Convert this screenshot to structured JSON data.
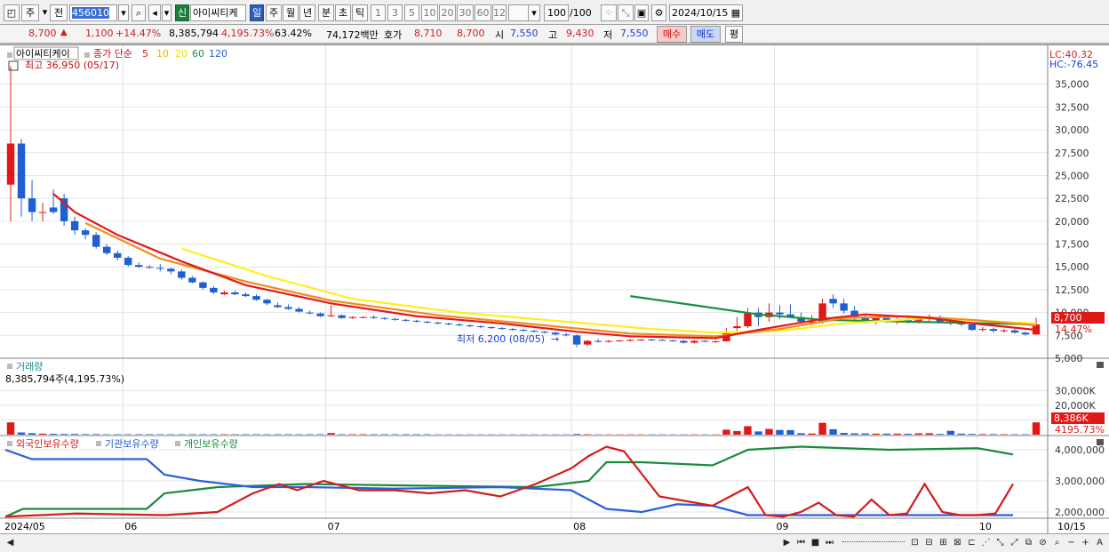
{
  "toolbar": {
    "market": "주",
    "prev": "전",
    "code": "456010",
    "badge": "신",
    "name": "아이씨티케",
    "periods": [
      "일",
      "주",
      "월",
      "년",
      "분",
      "초",
      "틱"
    ],
    "active_period": "일",
    "intervals": [
      "1",
      "3",
      "5",
      "10",
      "20",
      "30",
      "60",
      "120"
    ],
    "count": "100",
    "count_total": "/100",
    "date": "2024/10/15"
  },
  "quote": {
    "price": "8,700",
    "change_arrow": "▲",
    "change": "1,100",
    "change_rate": "+14.47%",
    "volume": "8,385,794",
    "volume_rate": "4,195.73%",
    "turnover": "63.42%",
    "amount": "74,172백만",
    "bid_label": "호가",
    "bid1": "8,710",
    "bid2": "8,700",
    "open_label": "시",
    "open": "7,550",
    "high_label": "고",
    "high": "9,430",
    "low_label": "저",
    "low": "7,550",
    "buy": "매수",
    "sell": "매도",
    "eval": "평"
  },
  "chart": {
    "legend_name": "아이씨티케이",
    "legend_ma_label": "종가 단순",
    "legend_ma": [
      {
        "label": "5",
        "color": "#e01b1b"
      },
      {
        "label": "10",
        "color": "#f0b400"
      },
      {
        "label": "20",
        "color": "#e8e000"
      },
      {
        "label": "60",
        "color": "#1a9040"
      },
      {
        "label": "120",
        "color": "#2060d0"
      }
    ],
    "lc": "LC:40.32",
    "hc": "HC:-76.45",
    "high_note": "최고 36,950 (05/17)",
    "low_note": "최저 6,200 (08/05)",
    "price_ticks": [
      "35,000",
      "32,500",
      "30,000",
      "27,500",
      "25,000",
      "22,500",
      "20,000",
      "17,500",
      "15,000",
      "12,500",
      "10,000",
      "7,500",
      "5,000"
    ],
    "price_tag": "8,700",
    "price_rate_tag": "14.47%",
    "volume_title": "거래량",
    "volume_info": "8,385,794주(4,195.73%)",
    "volume_ticks": [
      "30,000K",
      "20,000K",
      "10,000K"
    ],
    "volume_tag": "8,386K",
    "volume_rate_tag": "4195.73%",
    "holding_legend": [
      {
        "label": "외국인보유수량",
        "color": "#d41c1c"
      },
      {
        "label": "기관보유수량",
        "color": "#2060d0"
      },
      {
        "label": "개인보유수량",
        "color": "#1a8a3a"
      }
    ],
    "holding_ticks": [
      "4,000,000",
      "3,000,000",
      "2,000,000"
    ],
    "x_labels": [
      "2024/05",
      "06",
      "07",
      "08",
      "09",
      "10",
      "10/15"
    ]
  },
  "chart_data": {
    "type": "candlestick",
    "ohlc_daily": [
      [
        24000,
        36950,
        20000,
        28500
      ],
      [
        28500,
        29000,
        20500,
        22500
      ],
      [
        22500,
        24500,
        20000,
        21000
      ],
      [
        21000,
        22000,
        20000,
        21000
      ],
      [
        21500,
        23500,
        20800,
        21000
      ],
      [
        22500,
        23000,
        19500,
        20000
      ],
      [
        20000,
        20500,
        18500,
        19000
      ],
      [
        19000,
        19200,
        18000,
        18500
      ],
      [
        18500,
        18800,
        17000,
        17200
      ],
      [
        17200,
        17500,
        16300,
        16500
      ],
      [
        16500,
        16800,
        15700,
        16000
      ],
      [
        16000,
        16200,
        15000,
        15200
      ],
      [
        15200,
        15500,
        14900,
        15000
      ],
      [
        15000,
        15200,
        14800,
        14900
      ],
      [
        14900,
        15300,
        14500,
        14800
      ],
      [
        14800,
        14900,
        14200,
        14500
      ],
      [
        14500,
        14700,
        13600,
        13800
      ],
      [
        13800,
        14000,
        13200,
        13300
      ],
      [
        13300,
        13400,
        12500,
        12700
      ],
      [
        12700,
        12900,
        12000,
        12200
      ],
      [
        12000,
        12400,
        11900,
        12200
      ],
      [
        12200,
        12400,
        11900,
        12000
      ],
      [
        12000,
        12200,
        11700,
        11800
      ],
      [
        11800,
        12000,
        11300,
        11400
      ],
      [
        11400,
        11500,
        10800,
        11000
      ],
      [
        10800,
        11100,
        10500,
        10600
      ],
      [
        10600,
        10900,
        10300,
        10400
      ],
      [
        10400,
        10600,
        10000,
        10100
      ],
      [
        10000,
        10200,
        9800,
        9900
      ],
      [
        9900,
        10000,
        9500,
        9600
      ],
      [
        9600,
        10800,
        9500,
        9700
      ],
      [
        9700,
        9800,
        9300,
        9400
      ],
      [
        9400,
        9600,
        9300,
        9500
      ],
      [
        9500,
        9600,
        9400,
        9500
      ],
      [
        9500,
        9700,
        9300,
        9400
      ],
      [
        9400,
        9500,
        9200,
        9300
      ],
      [
        9300,
        9400,
        9100,
        9200
      ],
      [
        9200,
        9300,
        9000,
        9100
      ],
      [
        9100,
        9200,
        8900,
        9000
      ],
      [
        9000,
        9100,
        8800,
        8900
      ],
      [
        8900,
        9000,
        8700,
        8800
      ],
      [
        8800,
        8900,
        8600,
        8700
      ],
      [
        8700,
        8800,
        8500,
        8600
      ],
      [
        8600,
        8700,
        8400,
        8500
      ],
      [
        8500,
        8600,
        8300,
        8400
      ],
      [
        8400,
        8500,
        8200,
        8300
      ],
      [
        8300,
        8400,
        8100,
        8200
      ],
      [
        8200,
        8300,
        8000,
        8100
      ],
      [
        8100,
        8200,
        7900,
        8000
      ],
      [
        8000,
        8100,
        7800,
        7900
      ],
      [
        7900,
        8000,
        7700,
        7800
      ],
      [
        7800,
        7900,
        7500,
        7600
      ],
      [
        7600,
        7800,
        7400,
        7500
      ],
      [
        7500,
        7600,
        6200,
        6500
      ],
      [
        6500,
        7000,
        6300,
        6900
      ],
      [
        6900,
        7100,
        6700,
        6800
      ],
      [
        6800,
        7000,
        6700,
        6900
      ],
      [
        6900,
        7000,
        6800,
        6950
      ],
      [
        6950,
        7100,
        6850,
        7000
      ],
      [
        7000,
        7100,
        6900,
        7050
      ],
      [
        7050,
        7150,
        6900,
        7000
      ],
      [
        7000,
        7100,
        6900,
        6950
      ],
      [
        6950,
        7000,
        6800,
        6900
      ],
      [
        6900,
        7000,
        6600,
        6700
      ],
      [
        6700,
        7000,
        6600,
        6900
      ],
      [
        6900,
        7000,
        6750,
        6800
      ],
      [
        6800,
        7000,
        6700,
        6850
      ],
      [
        6850,
        8300,
        6800,
        7900
      ],
      [
        8300,
        9500,
        8000,
        8500
      ],
      [
        8500,
        10500,
        8300,
        10000
      ],
      [
        10000,
        10500,
        8500,
        9500
      ],
      [
        9500,
        11000,
        9000,
        10000
      ],
      [
        10000,
        10800,
        9300,
        9800
      ],
      [
        9800,
        10900,
        9400,
        9500
      ],
      [
        9500,
        10000,
        8800,
        9000
      ],
      [
        9000,
        9700,
        8600,
        9000
      ],
      [
        9000,
        11500,
        8800,
        11000
      ],
      [
        11500,
        12000,
        10500,
        11000
      ],
      [
        11000,
        11500,
        9900,
        10200
      ],
      [
        10200,
        10700,
        9200,
        9400
      ],
      [
        9400,
        9800,
        8800,
        9000
      ],
      [
        9000,
        9500,
        8700,
        9400
      ],
      [
        9400,
        9700,
        8900,
        9000
      ],
      [
        9000,
        9600,
        8700,
        9200
      ],
      [
        9200,
        9500,
        8800,
        9100
      ],
      [
        9100,
        9500,
        8800,
        9300
      ],
      [
        9300,
        9800,
        8900,
        9500
      ],
      [
        9500,
        9700,
        8900,
        9000
      ],
      [
        9000,
        9200,
        8600,
        8800
      ],
      [
        8800,
        9000,
        8500,
        8700
      ],
      [
        8700,
        8900,
        8000,
        8100
      ],
      [
        8100,
        8400,
        7900,
        8200
      ],
      [
        8200,
        8300,
        7800,
        8000
      ],
      [
        8000,
        8200,
        7800,
        8050
      ],
      [
        8050,
        8200,
        7700,
        7800
      ],
      [
        7800,
        7900,
        7500,
        7600
      ],
      [
        7600,
        9430,
        7550,
        8700
      ]
    ],
    "ma5": [
      [
        4,
        23000
      ],
      [
        6,
        21000
      ],
      [
        10,
        18500
      ],
      [
        16,
        15600
      ],
      [
        22,
        13000
      ],
      [
        30,
        11000
      ],
      [
        38,
        9600
      ],
      [
        46,
        8800
      ],
      [
        53,
        7900
      ],
      [
        58,
        7400
      ],
      [
        66,
        7200
      ],
      [
        70,
        8100
      ],
      [
        76,
        9300
      ],
      [
        80,
        9800
      ],
      [
        86,
        9400
      ],
      [
        91,
        8700
      ],
      [
        96,
        8100
      ]
    ],
    "ma10": [
      [
        7,
        19800
      ],
      [
        14,
        15900
      ],
      [
        22,
        13400
      ],
      [
        30,
        11300
      ],
      [
        40,
        9700
      ],
      [
        50,
        8600
      ],
      [
        58,
        7700
      ],
      [
        66,
        7400
      ],
      [
        72,
        8200
      ],
      [
        78,
        9400
      ],
      [
        84,
        9600
      ],
      [
        90,
        9200
      ],
      [
        96,
        8600
      ]
    ],
    "ma20": [
      [
        16,
        17000
      ],
      [
        24,
        14000
      ],
      [
        32,
        11500
      ],
      [
        42,
        10000
      ],
      [
        52,
        9000
      ],
      [
        60,
        8200
      ],
      [
        66,
        7800
      ],
      [
        72,
        8000
      ],
      [
        78,
        8800
      ],
      [
        86,
        9400
      ],
      [
        96,
        8800
      ]
    ],
    "ma60": [
      [
        58,
        11800
      ],
      [
        64,
        10800
      ],
      [
        70,
        9800
      ],
      [
        76,
        9200
      ],
      [
        84,
        9000
      ],
      [
        92,
        8800
      ],
      [
        96,
        8700
      ]
    ],
    "volume_k": [
      8386,
      1500,
      1000,
      700,
      600,
      500,
      500,
      400,
      400,
      300,
      300,
      300,
      300,
      300,
      300,
      300,
      300,
      300,
      300,
      300,
      300,
      300,
      300,
      300,
      300,
      300,
      300,
      300,
      300,
      300,
      1100,
      300,
      300,
      300,
      300,
      300,
      300,
      300,
      300,
      300,
      200,
      200,
      200,
      200,
      200,
      200,
      200,
      200,
      200,
      200,
      200,
      200,
      200,
      500,
      300,
      200,
      200,
      200,
      200,
      200,
      200,
      200,
      200,
      200,
      200,
      200,
      200,
      3400,
      2500,
      5800,
      2200,
      3900,
      3200,
      3100,
      1000,
      800,
      8100,
      3700,
      1200,
      900,
      800,
      700,
      700,
      700,
      600,
      900,
      1000,
      500,
      2600,
      700,
      500,
      400,
      400,
      300,
      300,
      300,
      8386
    ],
    "holding": {
      "x_labels": [
        "2024/05",
        "06",
        "07",
        "08",
        "09",
        "10",
        "10/15"
      ],
      "yticks": [
        4000000,
        3000000,
        2000000
      ],
      "foreign": [
        [
          0,
          1850000
        ],
        [
          8,
          1950000
        ],
        [
          18,
          1900000
        ],
        [
          24,
          2000000
        ],
        [
          28,
          2600000
        ],
        [
          31,
          2900000
        ],
        [
          33,
          2700000
        ],
        [
          36,
          3000000
        ],
        [
          40,
          2700000
        ],
        [
          44,
          2700000
        ],
        [
          48,
          2600000
        ],
        [
          52,
          2700000
        ],
        [
          56,
          2500000
        ],
        [
          60,
          2900000
        ],
        [
          64,
          3400000
        ],
        [
          66,
          3800000
        ],
        [
          68,
          4100000
        ],
        [
          70,
          3950000
        ],
        [
          74,
          2500000
        ],
        [
          78,
          2300000
        ],
        [
          80,
          2200000
        ],
        [
          82,
          2500000
        ],
        [
          84,
          2800000
        ],
        [
          86,
          1900000
        ],
        [
          88,
          1850000
        ],
        [
          90,
          2000000
        ],
        [
          92,
          2300000
        ],
        [
          94,
          1900000
        ],
        [
          96,
          1850000
        ],
        [
          98,
          2400000
        ],
        [
          100,
          1900000
        ],
        [
          102,
          1950000
        ],
        [
          104,
          2900000
        ],
        [
          106,
          2000000
        ],
        [
          108,
          1900000
        ],
        [
          110,
          1900000
        ],
        [
          112,
          1950000
        ],
        [
          114,
          2900000
        ]
      ],
      "institution": [
        [
          0,
          4000000
        ],
        [
          3,
          3700000
        ],
        [
          16,
          3700000
        ],
        [
          18,
          3200000
        ],
        [
          22,
          3000000
        ],
        [
          28,
          2800000
        ],
        [
          34,
          2800000
        ],
        [
          44,
          2750000
        ],
        [
          56,
          2800000
        ],
        [
          64,
          2700000
        ],
        [
          68,
          2100000
        ],
        [
          72,
          2000000
        ],
        [
          76,
          2250000
        ],
        [
          80,
          2200000
        ],
        [
          84,
          1900000
        ],
        [
          114,
          1900000
        ]
      ],
      "individual": [
        [
          0,
          1850000
        ],
        [
          2,
          2100000
        ],
        [
          16,
          2100000
        ],
        [
          18,
          2600000
        ],
        [
          24,
          2800000
        ],
        [
          34,
          2900000
        ],
        [
          46,
          2850000
        ],
        [
          60,
          2800000
        ],
        [
          66,
          3000000
        ],
        [
          68,
          3600000
        ],
        [
          72,
          3600000
        ],
        [
          80,
          3500000
        ],
        [
          84,
          4000000
        ],
        [
          90,
          4100000
        ],
        [
          100,
          4000000
        ],
        [
          110,
          4050000
        ],
        [
          114,
          3850000
        ]
      ]
    },
    "ylim_price": [
      5000,
      37500
    ]
  }
}
